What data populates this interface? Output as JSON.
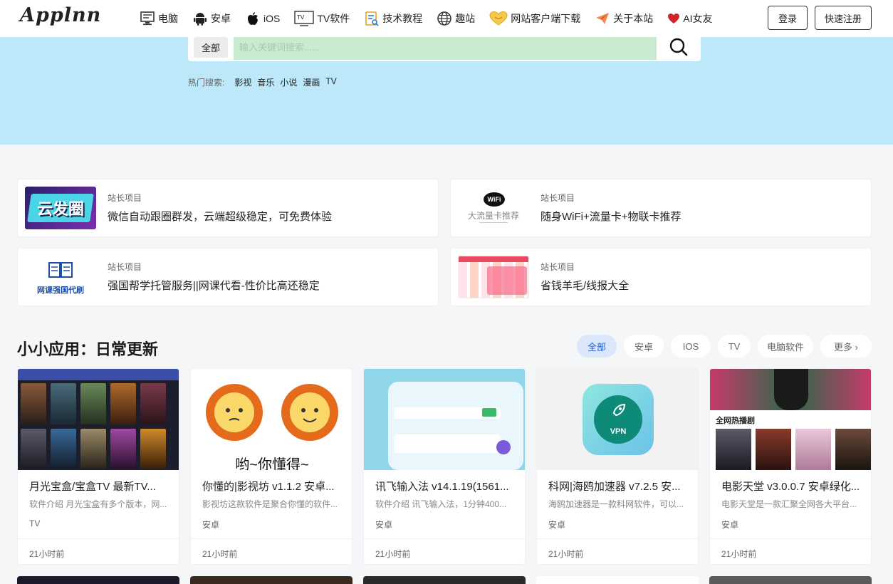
{
  "header": {
    "logo": "Applnn",
    "nav": [
      {
        "label": "电脑",
        "icon": "desktop-icon"
      },
      {
        "label": "安卓",
        "icon": "android-icon"
      },
      {
        "label": "iOS",
        "icon": "apple-icon"
      },
      {
        "label": "TV软件",
        "icon": "tv-icon"
      },
      {
        "label": "技术教程",
        "icon": "tutorial-icon"
      },
      {
        "label": "趣站",
        "icon": "globe-icon"
      },
      {
        "label": "网站客户端下载",
        "icon": "heart-badge-icon"
      },
      {
        "label": "关于本站",
        "icon": "paper-plane-icon"
      },
      {
        "label": "AI女友",
        "icon": "heart-icon"
      }
    ],
    "login": "登录",
    "register": "快速注册"
  },
  "search": {
    "category": "全部",
    "placeholder": "输入关键词搜索......",
    "hot_label": "热门搜索:",
    "hot_tags": [
      "影视",
      "音乐",
      "小说",
      "漫画",
      "TV"
    ]
  },
  "promos": [
    {
      "tag": "站长项目",
      "title": "微信自动跟圈群发，云端超级稳定，可免费体验",
      "thumb_text": "云发圈"
    },
    {
      "tag": "站长项目",
      "title": "随身WiFi+流量卡+物联卡推荐",
      "thumb_text": "大流量卡推荐",
      "thumb_badge": "WiFi"
    },
    {
      "tag": "站长项目",
      "title": "强国帮学托管服务||网课代看-性价比高还稳定",
      "thumb_text": "网课强国代刷"
    },
    {
      "tag": "站长项目",
      "title": "省钱羊毛/线报大全"
    }
  ],
  "section": {
    "title": "小小应用：日常更新",
    "filters": [
      "全部",
      "安卓",
      "IOS",
      "TV",
      "电脑软件",
      "更多 ›"
    ]
  },
  "cards": [
    {
      "title": "月光宝盒/宝盒TV 最新TV...",
      "desc": "软件介绍 月光宝盒有多个版本，网...",
      "category": "TV",
      "time": "21小时前"
    },
    {
      "title": "你懂的|影视坊 v1.1.2 安卓...",
      "desc": "影视坊这款软件是聚合你懂的软件...",
      "category": "安卓",
      "time": "21小时前",
      "img_text": "哟~你懂得~"
    },
    {
      "title": "讯飞输入法 v14.1.19(1561...",
      "desc": "软件介绍 讯飞输入法，1分钟400...",
      "category": "安卓",
      "time": "21小时前"
    },
    {
      "title": "科网|海鸥加速器 v7.2.5 安...",
      "desc": "海鸥加速器是一款科网软件，可以...",
      "category": "安卓",
      "time": "21小时前",
      "img_text": "VPN"
    },
    {
      "title": "电影天堂 v3.0.0.7 安卓绿化...",
      "desc": "电影天堂是一款汇聚全网各大平台...",
      "category": "安卓",
      "time": "21小时前",
      "img_text": "全网热播剧"
    }
  ],
  "colors": {
    "hero": "#bde8f9",
    "accent": "#2a5fd6"
  }
}
